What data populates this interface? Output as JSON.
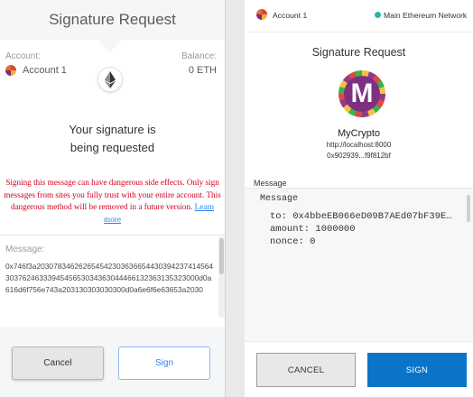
{
  "left": {
    "title": "Signature Request",
    "account_label": "Account:",
    "account_name": "Account 1",
    "balance_label": "Balance:",
    "balance_value": "0 ETH",
    "request_text": "Your signature is being requested",
    "warning_text": "Signing this message can have dangerous side effects. Only sign messages from sites you fully trust with your entire account. This dangerous method will be removed in a future version.",
    "learn_more": "Learn more",
    "message_label": "Message:",
    "message_hex": "0x746f3a2030783462626545423036366544303942374145643037624633394545653034363044466132363135323000d0a616d6f756e743a203130303030300d0a6e6f6e63653a2030",
    "cancel_label": "Cancel",
    "sign_label": "Sign"
  },
  "right": {
    "account_name": "Account 1",
    "network": "Main Ethereum Network",
    "title": "Signature Request",
    "logo_letter": "M",
    "site_name": "MyCrypto",
    "origin": "http://localhost:8000",
    "address": "0x902939...f9f812bf",
    "message_label": "Message",
    "message_head": "Message",
    "to_line": "to: 0x4bbeEB066eD09B7AEd07bF39E…",
    "amount_line": "amount: 1000000",
    "nonce_line": "nonce: 0",
    "cancel_label": "CANCEL",
    "sign_label": "SIGN"
  },
  "colors": {
    "warning": "#d0021b",
    "link": "#2f80ed",
    "sign_button": "#0a74c9",
    "network_dot": "#29b6af"
  }
}
